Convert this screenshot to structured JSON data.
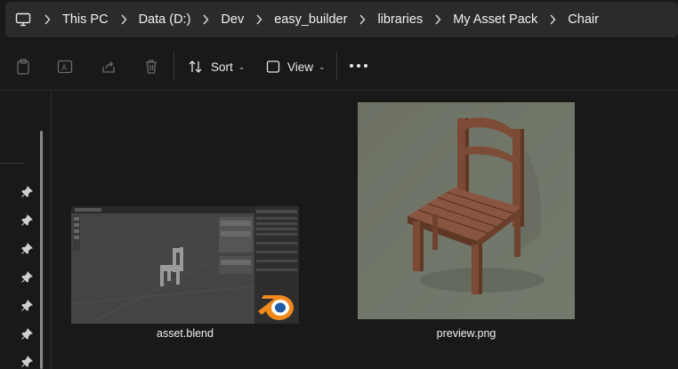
{
  "breadcrumb": {
    "items": [
      "This PC",
      "Data (D:)",
      "Dev",
      "easy_builder",
      "libraries",
      "My Asset Pack",
      "Chair"
    ]
  },
  "toolbar": {
    "sort_label": "Sort",
    "view_label": "View"
  },
  "files": [
    {
      "name": "asset.blend",
      "icon": "blender-icon"
    },
    {
      "name": "preview.png",
      "icon": "image-thumbnail"
    }
  ],
  "colors": {
    "background": "#191919",
    "address_bar": "#2b2b2b",
    "blender_orange": "#f08a1c",
    "blender_blue": "#1e5aa8",
    "chair_wood": "#7a4a34",
    "preview_bg": "#6f7566"
  }
}
